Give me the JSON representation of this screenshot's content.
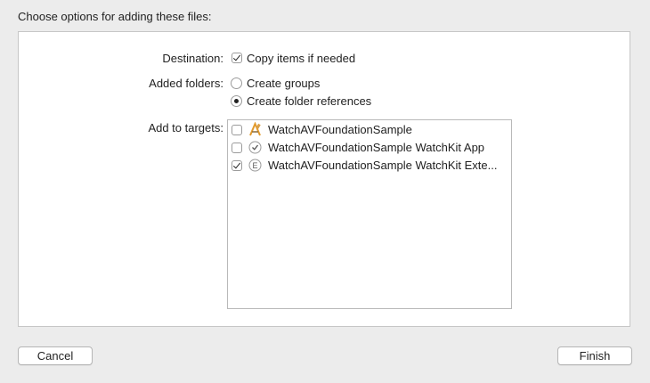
{
  "dialog": {
    "title": "Choose options for adding these files:"
  },
  "destination": {
    "label": "Destination:",
    "option": {
      "label": "Copy items if needed",
      "checked": true
    }
  },
  "added_folders": {
    "label": "Added folders:",
    "options": [
      {
        "label": "Create groups",
        "selected": false
      },
      {
        "label": "Create folder references",
        "selected": true
      }
    ]
  },
  "add_to_targets": {
    "label": "Add to targets:",
    "targets": [
      {
        "label": "WatchAVFoundationSample",
        "checked": false,
        "icon": "app-icon"
      },
      {
        "label": "WatchAVFoundationSample WatchKit App",
        "checked": false,
        "icon": "watchkit-app-icon"
      },
      {
        "label": "WatchAVFoundationSample WatchKit Exte...",
        "checked": true,
        "icon": "extension-icon"
      }
    ]
  },
  "buttons": {
    "cancel": "Cancel",
    "finish": "Finish"
  }
}
